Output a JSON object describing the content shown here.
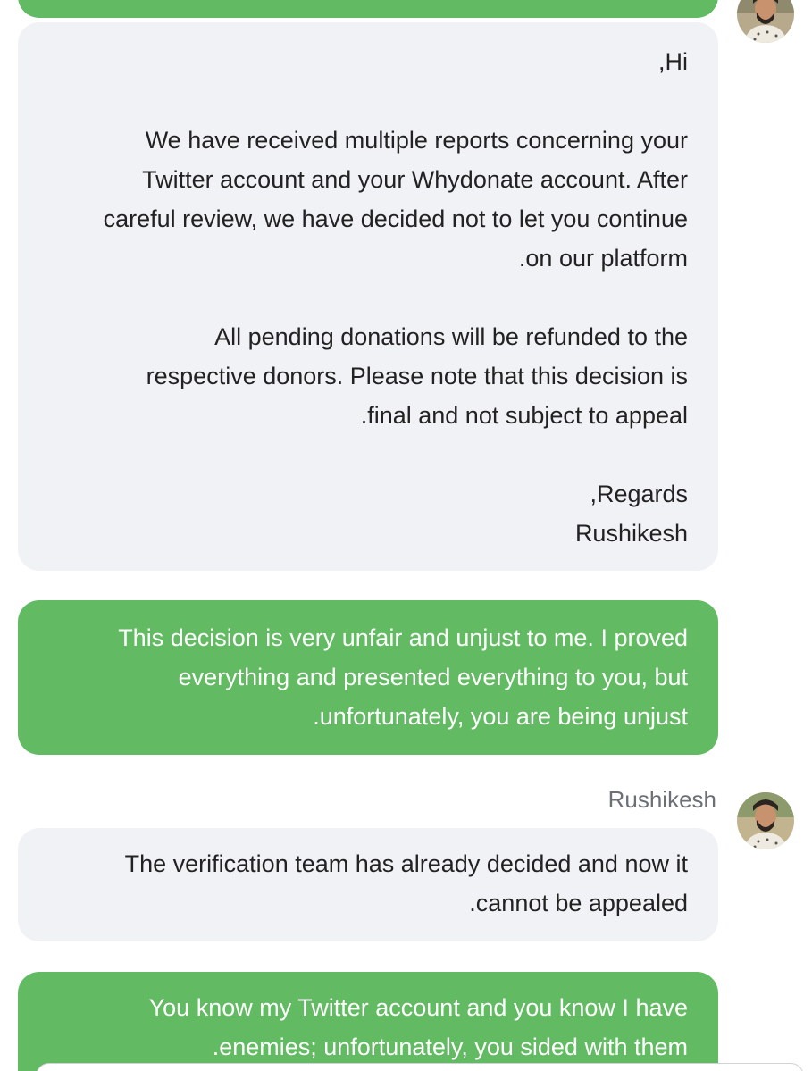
{
  "chat": {
    "messages": [
      {
        "from": "Rushikesh",
        "lines": [
          ",Hi",
          "",
          "We have received multiple reports concerning your",
          "Twitter account and your Whydonate account. After",
          "careful review, we have decided not to let you continue",
          ".on our platform",
          "",
          "All pending donations will be refunded to the",
          "respective donors. Please note that this decision is",
          ".final and not subject to appeal",
          "",
          ",Regards",
          "Rushikesh"
        ]
      },
      {
        "from": "self",
        "lines": [
          "This decision is very unfair and unjust to me. I proved",
          "everything and presented everything to you, but",
          ".unfortunately, you are being unjust"
        ]
      },
      {
        "from": "Rushikesh",
        "sender_name": "Rushikesh",
        "lines": [
          "The verification team has already decided and now it",
          ".cannot be appealed"
        ]
      },
      {
        "from": "self",
        "lines": [
          "You know my Twitter account and you know I have",
          ".enemies; unfortunately, you sided with them"
        ]
      }
    ]
  },
  "colors": {
    "outgoing_bubble": "#62bb62",
    "incoming_bubble": "#f1f2f6",
    "sender_name": "#6b6f76"
  },
  "icons": {
    "agent_avatar": "avatar-photo"
  }
}
